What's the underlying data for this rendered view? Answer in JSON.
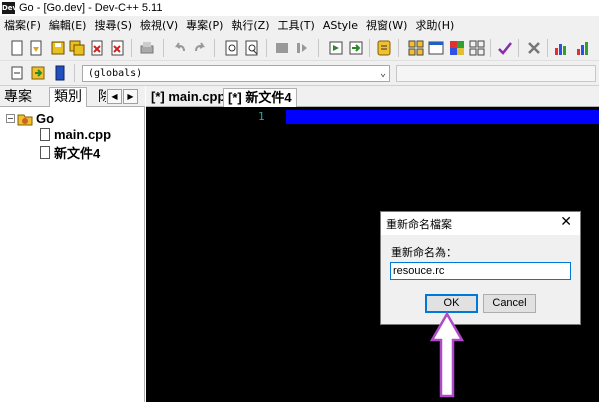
{
  "window": {
    "title": "Go - [Go.dev] - Dev-C++ 5.11",
    "app_icon_text": "Dev"
  },
  "menu": [
    "檔案(F)",
    "編輯(E)",
    "搜尋(S)",
    "檢視(V)",
    "專案(P)",
    "執行(Z)",
    "工具(T)",
    "AStyle",
    "視窗(W)",
    "求助(H)"
  ],
  "toolbar": {
    "scope_select_value": "(globals)"
  },
  "left_panel": {
    "tabs": [
      "專案",
      "類別",
      "除"
    ],
    "tree": {
      "root": "Go",
      "root_toggle": "−",
      "children": [
        "main.cpp",
        "新文件4"
      ]
    }
  },
  "editor": {
    "tabs": [
      "[*] main.cpp",
      "[*] 新文件4"
    ],
    "line_number": "1"
  },
  "dialog": {
    "title": "重新命名檔案",
    "label": "重新命名為：",
    "input_value": "resouce.rc",
    "ok_label": "OK",
    "cancel_label": "Cancel",
    "close_glyph": "✕"
  },
  "colors": {
    "editor_bg": "#000000",
    "selection": "#0000ff",
    "line_number": "#18b0a8",
    "annotation_arrow": "#b04ac8"
  }
}
